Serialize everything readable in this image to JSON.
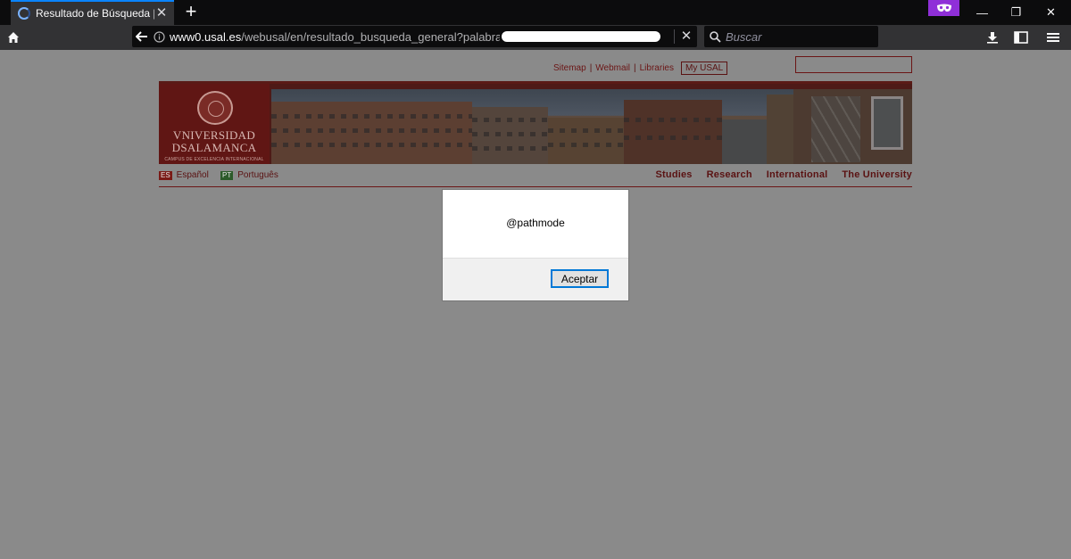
{
  "browser": {
    "tab": {
      "title": "Resultado de Búsqueda | Uni",
      "close": "✕"
    },
    "new_tab": "+",
    "url": {
      "host": "www0.usal.es",
      "path": "/webusal/en/resultado_busqueda_general?palabras_clav"
    },
    "url_clear": "✕",
    "search_placeholder": "Buscar",
    "window_controls": {
      "minimize": "—",
      "restore": "❐",
      "close": "✕"
    }
  },
  "site": {
    "top_links": [
      "Sitemap",
      "Webmail",
      "Libraries"
    ],
    "my_usal": "My USAL",
    "logo": {
      "line1": "VNIVERSIDAD",
      "line2": "DSALAMANCA",
      "line3": "CAMPUS DE EXCELENCIA INTERNACIONAL"
    },
    "languages": {
      "es": {
        "code": "ES",
        "label": "Español"
      },
      "pt": {
        "code": "PT",
        "label": "Português"
      }
    },
    "main_nav": [
      "Studies",
      "Research",
      "International",
      "The University"
    ]
  },
  "dialog": {
    "message": "@pathmode",
    "ok_button": "Aceptar"
  },
  "colors": {
    "accent": "#0a84ff",
    "brand": "#6b1515",
    "private_badge": "#8f2fd8"
  }
}
